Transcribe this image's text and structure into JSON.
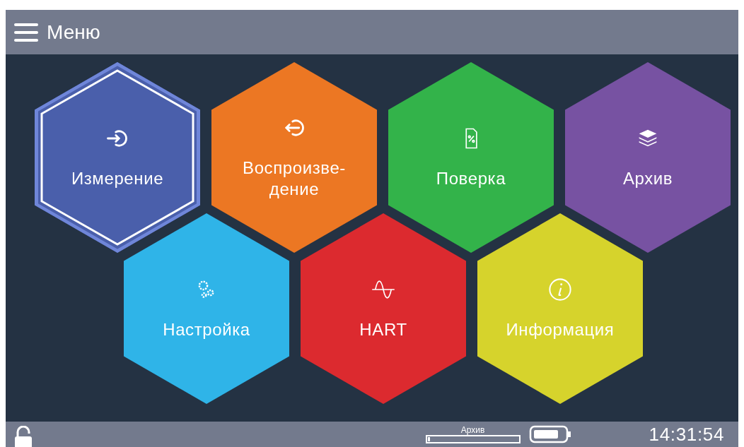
{
  "header": {
    "title": "Меню"
  },
  "rows": [
    [
      {
        "label": "Измерение",
        "kind": "input",
        "color": "#4a5fab",
        "selected": true
      },
      {
        "label": "Воспроизве-\nдение",
        "kind": "output",
        "color": "#ec7723",
        "selected": false
      },
      {
        "label": "Поверка",
        "kind": "verification",
        "color": "#33b34a",
        "selected": false
      },
      {
        "label": "Архив",
        "kind": "archive",
        "color": "#7752a2",
        "selected": false
      }
    ],
    [
      {
        "label": "Настройка",
        "kind": "settings",
        "color": "#2fb4e8",
        "selected": false
      },
      {
        "label": "HART",
        "kind": "signal",
        "color": "#dc2a2f",
        "selected": false
      },
      {
        "label": "Информация",
        "kind": "info",
        "color": "#d6d32c",
        "selected": false
      }
    ]
  ],
  "status_bar": {
    "archive": {
      "label": "Архив",
      "level": 0.03
    },
    "time": "14:31:54"
  }
}
